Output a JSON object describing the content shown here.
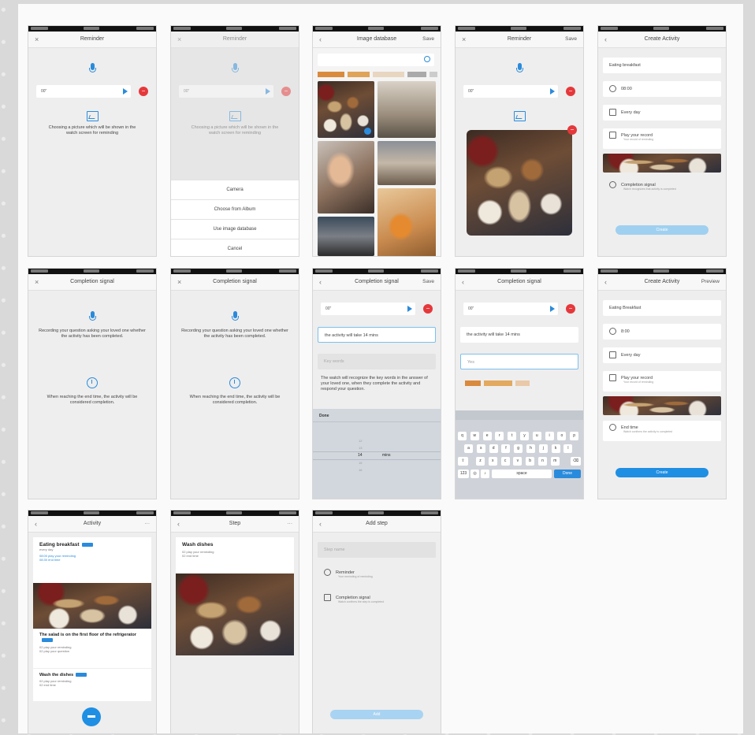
{
  "screens": {
    "s1": {
      "title": "Reminder",
      "recording_len": "00\"",
      "hint": "Choosing a picture which will be shown in the watch screen for reminding"
    },
    "s2": {
      "title": "Reminder",
      "recording_len": "00\"",
      "hint": "Choosing a picture which will be shown in the watch screen for reminding",
      "options": [
        "Camera",
        "Choose from Album",
        "Use image database",
        "Cancel"
      ]
    },
    "s3": {
      "title": "Image database",
      "save": "Save"
    },
    "s4": {
      "title": "Reminder",
      "save": "Save",
      "recording_len": "00\""
    },
    "s5": {
      "title": "Create Activity",
      "name": "Eating breakfast",
      "time": "08:00",
      "repeat": "Every day",
      "record": "Play your record",
      "record_sub": "Your record of reminding",
      "signal": "Completion signal",
      "signal_sub": "Watch recognizes that activity is completed",
      "create": "Create"
    },
    "s6": {
      "title": "Completion signal",
      "text1": "Recording your question asking your loved one whether the activity has been completed.",
      "text2": "When reaching the end time, the activity will be considered completion."
    },
    "s7": {
      "title": "Completion signal",
      "text1": "Recording your question asking your loved one whether the activity has been completed.",
      "text2": "When reaching the end time, the activity will be considered completion."
    },
    "s8": {
      "title": "Completion signal",
      "save": "Save",
      "recording_len": "00\"",
      "field1": "the activity will take 14 mins",
      "field2": "Key words",
      "note": "The watch will recognize the key words in the answer of your loved one, when they complete the activity and respond your question.",
      "picker_done": "Done",
      "picker_value": "14",
      "picker_unit": "mins"
    },
    "s9": {
      "title": "Completion signal",
      "recording_len": "00\"",
      "field1": "the activity will take 14 mins",
      "field2": "Yes",
      "keys_row1": [
        "q",
        "w",
        "e",
        "r",
        "t",
        "y",
        "u",
        "i",
        "o",
        "p"
      ],
      "keys_row2": [
        "a",
        "s",
        "d",
        "f",
        "g",
        "h",
        "j",
        "k",
        "l"
      ],
      "keys_row3": [
        "z",
        "x",
        "c",
        "v",
        "b",
        "n",
        "m"
      ],
      "space": "space",
      "done": "Done"
    },
    "s10": {
      "title": "Create Activity",
      "preview": "Preview",
      "name": "Eating Breakfast",
      "time": "8:00",
      "repeat": "Every day",
      "record": "Play your record",
      "record_sub": "Your record of reminding",
      "end": "End time",
      "end_sub": "Watch confirms the activity is completed",
      "create": "Create"
    },
    "s11": {
      "title": "Activity",
      "a1": "Eating  breakfast",
      "a1_sub": "every day",
      "a1_l1": "08:00 play your reminding",
      "a1_l2": "08:30 end time",
      "a2": "The salad is on the first floor of the refrigerator",
      "a2_l1": "02 play your reminding",
      "a2_l2": "02 play your question",
      "a3": "Wash the dishes",
      "a3_l1": "02 play your reminding",
      "a3_l2": "02 end time"
    },
    "s12": {
      "title": "Step",
      "name": "Wash dishes",
      "l1": "02 play your reminding",
      "l2": "02 end time"
    },
    "s13": {
      "title": "Add step",
      "name": "Step name",
      "r1": "Reminder",
      "r1_sub": "Your reminding of reminding",
      "r2": "Completion signal",
      "r2_sub": "Watch confirms the step is completed",
      "btn": "Add"
    }
  }
}
